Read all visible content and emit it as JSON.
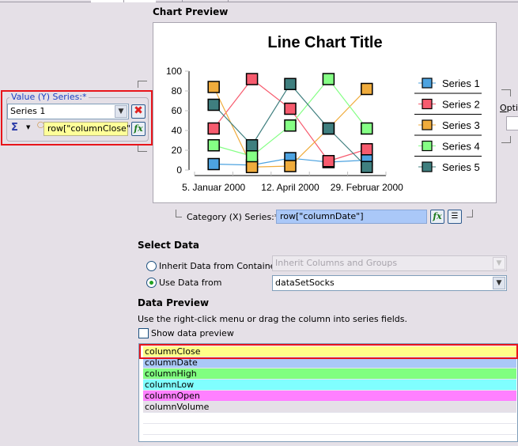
{
  "header": {
    "chart_preview_title": "Chart Preview"
  },
  "value_series": {
    "legend": "Value (Y) Series:*",
    "selected_series": "Series 1",
    "aggregate_icon": "sigma-icon",
    "expression": "row[\"columnClose\"]"
  },
  "category_series": {
    "label": "Category (X) Series:*",
    "expression": "row[\"columnDate\"]"
  },
  "optional_label": "Optio",
  "select_data": {
    "title": "Select Data",
    "inherit_label": "Inherit Data from Container",
    "inherit_value": "Inherit Columns and Groups",
    "use_data_label": "Use Data from",
    "use_data_value": "dataSetSocks",
    "selected_option": "use_data"
  },
  "data_preview": {
    "title": "Data Preview",
    "hint": "Use the right-click menu or drag the column into series fields.",
    "show_preview_label": "Show data preview",
    "show_preview_checked": false,
    "columns": [
      {
        "name": "columnClose",
        "color": "#ffff88"
      },
      {
        "name": "columnDate",
        "color": "#aac8f8"
      },
      {
        "name": "columnHigh",
        "color": "#80ff80"
      },
      {
        "name": "columnLow",
        "color": "#80ffff"
      },
      {
        "name": "columnOpen",
        "color": "#ff80ff"
      },
      {
        "name": "columnVolume",
        "color": "#e5e0e7"
      }
    ]
  },
  "chart_data": {
    "type": "line",
    "title": "Line Chart Title",
    "xlabel": "",
    "ylabel": "",
    "ylim": [
      0,
      100
    ],
    "yticks": [
      0,
      20,
      40,
      60,
      80,
      100
    ],
    "x_tick_labels": [
      "5. Januar 2000",
      "12. April 2000",
      "29. Februar 2000"
    ],
    "grid": false,
    "legend_position": "right",
    "series": [
      {
        "name": "Series 1",
        "color": "#4da3e0",
        "values": [
          6,
          5,
          12,
          8,
          10
        ]
      },
      {
        "name": "Series 2",
        "color": "#f75b6e",
        "values": [
          42,
          92,
          62,
          9,
          21
        ]
      },
      {
        "name": "Series 3",
        "color": "#f0ac3c",
        "values": [
          84,
          3,
          4,
          42,
          82
        ]
      },
      {
        "name": "Series 4",
        "color": "#85ff85",
        "values": [
          25,
          14,
          45,
          92,
          42
        ]
      },
      {
        "name": "Series 5",
        "color": "#3f7f7f",
        "values": [
          66,
          25,
          87,
          42,
          3
        ]
      }
    ]
  }
}
